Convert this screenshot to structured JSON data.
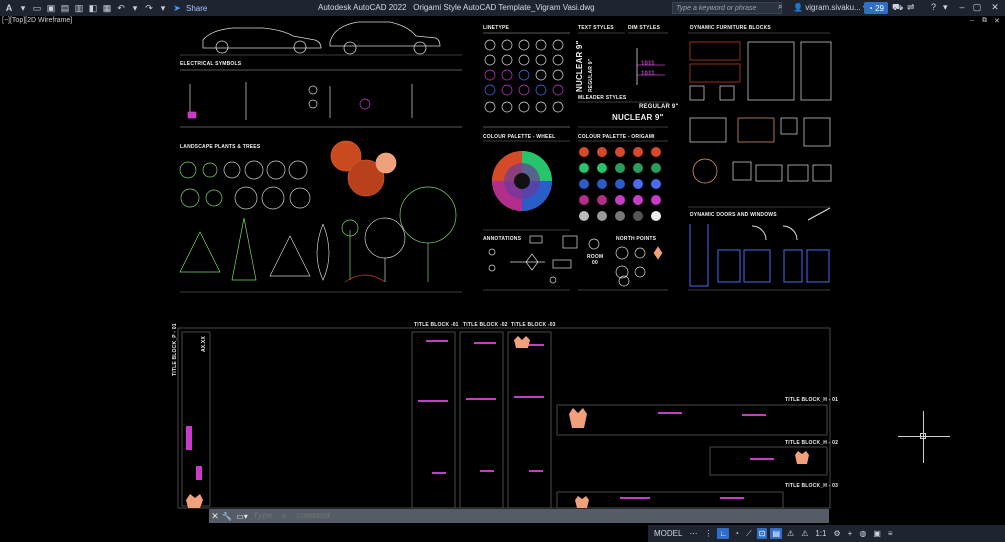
{
  "app": {
    "title": "Autodesk AutoCAD 2022",
    "document": "Origami Style AutoCAD Template_Vigram Vasi.dwg",
    "share_label": "Share",
    "search_placeholder": "Type a keyword or phrase",
    "user": "vigram.sivaku...",
    "notification_count": "29",
    "logo": "A"
  },
  "viewport": {
    "label": "[−][Top][2D Wireframe]"
  },
  "sections": {
    "electrical": "ELECTRICAL SYMBOLS",
    "landscape": "LANDSCAPE PLANTS & TREES",
    "linetype": "LINETYPE",
    "text_styles": "TEXT STYLES",
    "dim_styles": "DIM STYLES",
    "mleader": "MLEADER STYLES",
    "palette_wheel": "COLOUR PALETTE - WHEEL",
    "palette_origami": "COLOUR PALETTE - ORIGAMI",
    "annotations": "ANNOTATIONS",
    "north_points": "NORTH POINTS",
    "furniture": "DYNAMIC FURNITURE BLOCKS",
    "doors": "DYNAMIC DOORS AND WINDOWS",
    "tb1": "TITLE BLOCK -01",
    "tb2": "TITLE BLOCK -02",
    "tb3": "TITLE BLOCK -03",
    "tb_p": "TITLE BLOCK_P - 01",
    "tbh1": "TITLE BLOCK_H - 01",
    "tbh2": "TITLE BLOCK_H - 02",
    "tbh3": "TITLE BLOCK_H - 03"
  },
  "samples": {
    "nuclear9": "NUCLEAR 9\"",
    "regular9": "REGULAR 9\"",
    "nuclear9_b": "NUCLEAR 9\"",
    "regular9_b": "REGULAR 9\"",
    "dim1": "1011",
    "dim2": "1011",
    "room": "ROOM",
    "room_no": "00",
    "axxx": "AX.XX"
  },
  "command": {
    "placeholder": "Type  a  command"
  },
  "status": {
    "model": "MODEL",
    "scale": "1:1"
  },
  "colors": {
    "magenta": "#c83cc8",
    "orange": "#d0451b",
    "accent": "#2f6fc9"
  }
}
